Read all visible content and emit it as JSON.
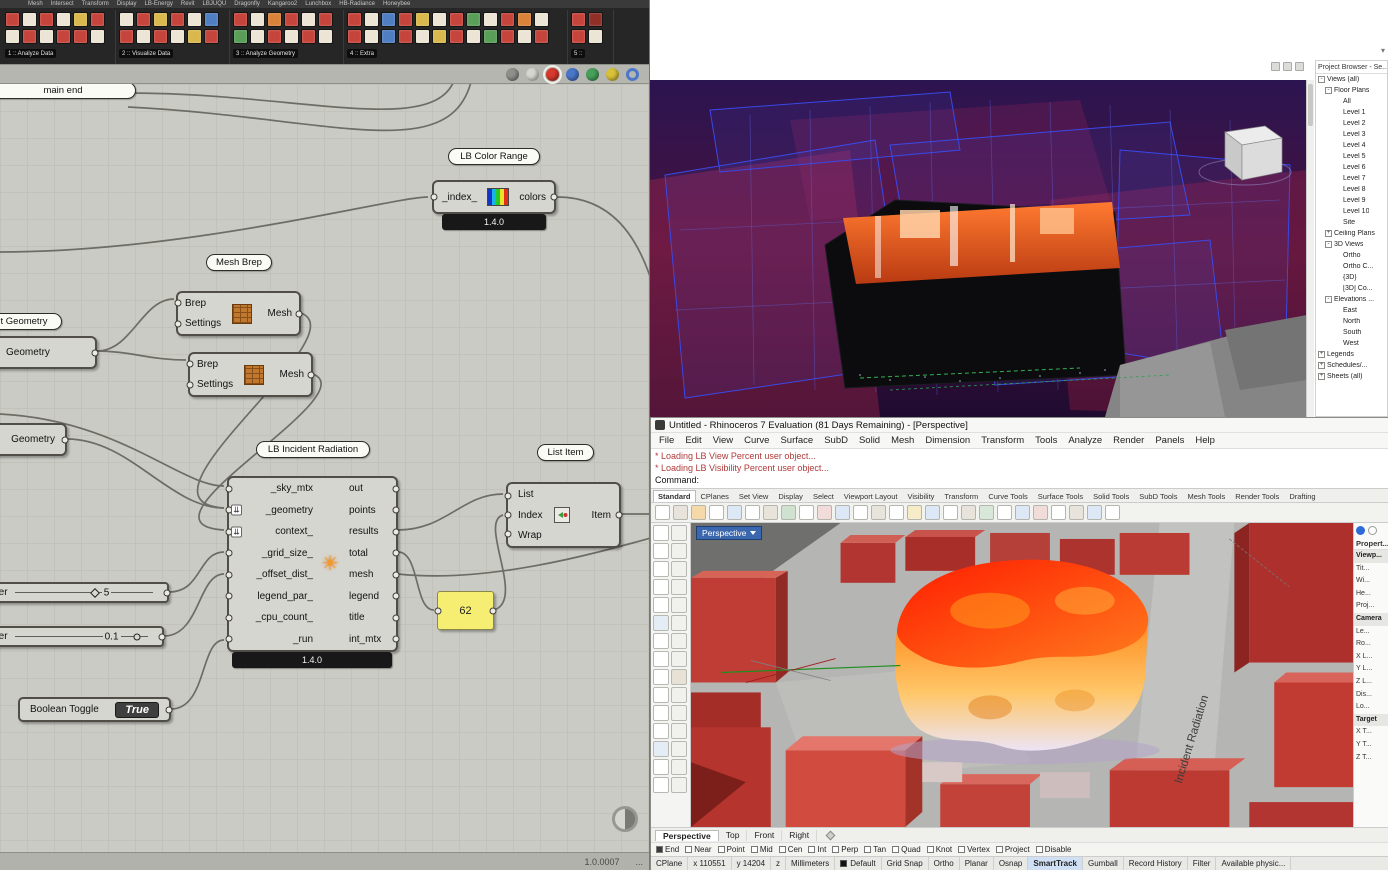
{
  "gh": {
    "tabs": [
      "Mesh",
      "Intersect",
      "Transform",
      "Display",
      "LB-Energy",
      "Revit",
      "LBJUQU",
      "Dragonfly",
      "Kangaroo2",
      "Lunchbox",
      "HB-Radiance",
      "Honeybee"
    ],
    "toolbar_groups": [
      {
        "label": "1 :: Analyze Data",
        "icons": [
          "#c5453c",
          "#ece5d5",
          "#c5453c",
          "#ece5d5",
          "#d9b94e",
          "#c5453c",
          "#ece5d5",
          "#c5453c",
          "#ece5d5",
          "#c5453c",
          "#c5453c",
          "#ece5d5"
        ]
      },
      {
        "label": "2 :: Visualize Data",
        "icons": [
          "#ece5d5",
          "#c5453c",
          "#d9b94e",
          "#c5453c",
          "#ece5d5",
          "#4f7ec2",
          "#c5453c",
          "#ece5d5",
          "#c5453c",
          "#ece5d5",
          "#d9b94e",
          "#c5453c"
        ]
      },
      {
        "label": "3 :: Analyze Geometry",
        "icons": [
          "#c5453c",
          "#ece5d5",
          "#d9823a",
          "#c5453c",
          "#ece5d5",
          "#c5453c",
          "#5a9e5a",
          "#ece5d5",
          "#c5453c",
          "#ece5d5",
          "#c5453c",
          "#ece5d5"
        ]
      },
      {
        "label": "4 :: Extra",
        "icons": [
          "#c5453c",
          "#ece5d5",
          "#4f7ec2",
          "#c5453c",
          "#d9b94e",
          "#ece5d5",
          "#c5453c",
          "#5a9e5a",
          "#ece5d5",
          "#c5453c",
          "#d9823a",
          "#ece5d5",
          "#c5453c",
          "#ece5d5",
          "#4f7ec2",
          "#c5453c",
          "#ece5d5",
          "#d9b94e",
          "#c5453c",
          "#ece5d5",
          "#5a9e5a",
          "#c5453c",
          "#ece5d5",
          "#c5453c"
        ]
      },
      {
        "label": "5 ::",
        "icons": [
          "#c5453c",
          "#8f2f28",
          "#c5453c",
          "#ece5d5"
        ]
      }
    ],
    "display_icons": [
      {
        "bg": "#8f8f8b"
      },
      {
        "bg": "#d6d6d0"
      },
      {
        "bg": "#d8392c",
        "cls": "sel"
      },
      {
        "bg": "#4a77c9"
      },
      {
        "bg": "#49a05c"
      },
      {
        "bg": "#d8c23a"
      },
      {
        "bg": "#d6d6d0",
        "cls": "ring"
      }
    ],
    "status_version": "1.0.0007",
    "status_dots": "...",
    "group_label_main": "main end",
    "color_range": {
      "title": "LB Color Range",
      "input": "_index_",
      "output": "colors",
      "version": "1.4.0"
    },
    "mesh_brep_label": "Mesh Brep",
    "brep": {
      "inputs": [
        "Brep",
        "Settings"
      ],
      "output": "Mesh"
    },
    "geometry_label_top": "t Geometry",
    "geometry_param": "Geometry",
    "geometry_param2": "Geometry",
    "radiation": {
      "title": "LB Incident Radiation",
      "inputs": [
        {
          "label": "_sky_mtx"
        },
        {
          "label": "_geometry",
          "cls": "flat"
        },
        {
          "label": "context_",
          "cls": "flat"
        },
        {
          "label": "_grid_size_"
        },
        {
          "label": "_offset_dist_"
        },
        {
          "label": "legend_par_"
        },
        {
          "label": "_cpu_count_"
        },
        {
          "label": "_run"
        }
      ],
      "outputs": [
        "out",
        "points",
        "results",
        "total",
        "mesh",
        "legend",
        "title",
        "int_mtx"
      ],
      "version": "1.4.0"
    },
    "list_item": {
      "title": "List Item",
      "inputs": [
        "List",
        "Index",
        "Wrap"
      ],
      "output": "Item"
    },
    "panel_value": "62",
    "slider1": {
      "label": "Slider",
      "value": "5"
    },
    "slider2": {
      "label": "Slider",
      "value": "0.1"
    },
    "toggle": {
      "label": "Boolean Toggle",
      "value": "True"
    }
  },
  "revit": {
    "browser_title": "Project Browser - Se...",
    "tree": [
      {
        "glyph": "-",
        "label": "Views (all)",
        "cls": "lvl0"
      },
      {
        "glyph": "-",
        "label": "Floor Plans",
        "cls": "lvl1"
      },
      {
        "glyph": "",
        "label": "All",
        "cls": "lvl2"
      },
      {
        "glyph": "",
        "label": "Level 1",
        "cls": "lvl2"
      },
      {
        "glyph": "",
        "label": "Level 2",
        "cls": "lvl2"
      },
      {
        "glyph": "",
        "label": "Level 3",
        "cls": "lvl2"
      },
      {
        "glyph": "",
        "label": "Level 4",
        "cls": "lvl2"
      },
      {
        "glyph": "",
        "label": "Level 5",
        "cls": "lvl2"
      },
      {
        "glyph": "",
        "label": "Level 6",
        "cls": "lvl2"
      },
      {
        "glyph": "",
        "label": "Level 7",
        "cls": "lvl2"
      },
      {
        "glyph": "",
        "label": "Level 8",
        "cls": "lvl2"
      },
      {
        "glyph": "",
        "label": "Level 9",
        "cls": "lvl2"
      },
      {
        "glyph": "",
        "label": "Level 10",
        "cls": "lvl2"
      },
      {
        "glyph": "",
        "label": "Site",
        "cls": "lvl2"
      },
      {
        "glyph": "+",
        "label": "Ceiling Plans",
        "cls": "lvl1"
      },
      {
        "glyph": "-",
        "label": "3D Views",
        "cls": "lvl1"
      },
      {
        "glyph": "",
        "label": "Ortho",
        "cls": "lvl2"
      },
      {
        "glyph": "",
        "label": "Ortho C...",
        "cls": "lvl2"
      },
      {
        "glyph": "",
        "label": "{3D}",
        "cls": "lvl2"
      },
      {
        "glyph": "",
        "label": "[3D] Co...",
        "cls": "lvl2"
      },
      {
        "glyph": "-",
        "label": "Elevations ...",
        "cls": "lvl1"
      },
      {
        "glyph": "",
        "label": "East",
        "cls": "lvl2"
      },
      {
        "glyph": "",
        "label": "North",
        "cls": "lvl2"
      },
      {
        "glyph": "",
        "label": "South",
        "cls": "lvl2"
      },
      {
        "glyph": "",
        "label": "West",
        "cls": "lvl2"
      },
      {
        "glyph": "+",
        "label": "Legends",
        "cls": "lvl0"
      },
      {
        "glyph": "+",
        "label": "Schedules/...",
        "cls": "lvl0"
      },
      {
        "glyph": "+",
        "label": "Sheets (all)",
        "cls": "lvl0"
      }
    ]
  },
  "rhino": {
    "title": "Untitled - Rhinoceros 7 Evaluation (81 Days Remaining) - [Perspective]",
    "menus": [
      "File",
      "Edit",
      "View",
      "Curve",
      "Surface",
      "SubD",
      "Solid",
      "Mesh",
      "Dimension",
      "Transform",
      "Tools",
      "Analyze",
      "Render",
      "Panels",
      "Help"
    ],
    "command_history": [
      "* Loading LB View Percent user object...",
      "* Loading LB Visibility Percent user object..."
    ],
    "command_prompt": "Command:",
    "tool_tabs": [
      {
        "label": "Standard",
        "cls": "active"
      },
      {
        "label": "CPlanes"
      },
      {
        "label": "Set View"
      },
      {
        "label": "Display"
      },
      {
        "label": "Select"
      },
      {
        "label": "Viewport Layout"
      },
      {
        "label": "Visibility"
      },
      {
        "label": "Transform"
      },
      {
        "label": "Curve Tools"
      },
      {
        "label": "Surface Tools"
      },
      {
        "label": "Solid Tools"
      },
      {
        "label": "SubD Tools"
      },
      {
        "label": "Mesh Tools"
      },
      {
        "label": "Render Tools"
      },
      {
        "label": "Drafting"
      }
    ],
    "toolbar_icons": [
      "#ffffff",
      "#e8e4dc",
      "#f6d9a8",
      "#ffffff",
      "#dce8f6",
      "#ffffff",
      "#e8e4dc",
      "#cfe2cf",
      "#ffffff",
      "#f2dcda",
      "#dce8f6",
      "#ffffff",
      "#e8e4dc",
      "#ffffff",
      "#f6ecc8",
      "#dce8f6",
      "#ffffff",
      "#e8e4dc",
      "#d8e8d8",
      "#ffffff",
      "#dce8f6",
      "#f2dcda",
      "#ffffff",
      "#e8e4dc",
      "#dce8f6",
      "#ffffff"
    ],
    "sidebar_icons": [
      "#ffffff",
      "#f1f1ee",
      "#ffffff",
      "#f1f1ee",
      "#ffffff",
      "#f1f1ee",
      "#ffffff",
      "#f1f1ee",
      "#ffffff",
      "#f1f1ee",
      "#e4ecf6",
      "#f1f1ee",
      "#ffffff",
      "#f1f1ee",
      "#ffffff",
      "#f1f1ee",
      "#ffffff",
      "#e8e2d6",
      "#ffffff",
      "#f1f1ee",
      "#ffffff",
      "#f1f1ee",
      "#ffffff",
      "#f1f1ee",
      "#e4ecf6",
      "#f1f1ee",
      "#ffffff",
      "#f1f1ee",
      "#ffffff",
      "#f1f1ee"
    ],
    "viewport_label": "Perspective",
    "scene_annotation": "Incident Radiation",
    "view_tabs": [
      {
        "label": "Perspective",
        "cls": "active"
      },
      {
        "label": "Top"
      },
      {
        "label": "Front"
      },
      {
        "label": "Right"
      }
    ],
    "osnap": [
      {
        "label": "End",
        "cls": "checked"
      },
      {
        "label": "Near"
      },
      {
        "label": "Point"
      },
      {
        "label": "Mid"
      },
      {
        "label": "Cen"
      },
      {
        "label": "Int"
      },
      {
        "label": "Perp"
      },
      {
        "label": "Tan"
      },
      {
        "label": "Quad"
      },
      {
        "label": "Knot"
      },
      {
        "label": "Vertex"
      },
      {
        "label": "Project"
      },
      {
        "label": "Disable"
      }
    ],
    "status": {
      "cplane": "CPlane",
      "x": "x 110551",
      "y": "y 14204",
      "z": "z",
      "units": "Millimeters",
      "layer": "Default"
    },
    "status_toggles": [
      {
        "label": "Grid Snap"
      },
      {
        "label": "Ortho"
      },
      {
        "label": "Planar"
      },
      {
        "label": "Osnap"
      },
      {
        "label": "SmartTrack",
        "cls": "active"
      },
      {
        "label": "Gumball"
      },
      {
        "label": "Record History"
      },
      {
        "label": "Filter"
      },
      {
        "label": "Available physic..."
      }
    ],
    "props_title": "Propert...",
    "props_rows": [
      {
        "label": "Viewp...",
        "cls": "hdr"
      },
      {
        "label": "Tit..."
      },
      {
        "label": "Wi..."
      },
      {
        "label": "He..."
      },
      {
        "label": "Proj..."
      },
      {
        "label": "Camera",
        "cls": "hdr"
      },
      {
        "label": "Le..."
      },
      {
        "label": "Ro..."
      },
      {
        "label": "X L..."
      },
      {
        "label": "Y L..."
      },
      {
        "label": "Z L..."
      },
      {
        "label": "Dis..."
      },
      {
        "label": "Lo..."
      },
      {
        "label": "Target",
        "cls": "hdr"
      },
      {
        "label": "X T..."
      },
      {
        "label": "Y T..."
      },
      {
        "label": "Z T..."
      }
    ]
  }
}
